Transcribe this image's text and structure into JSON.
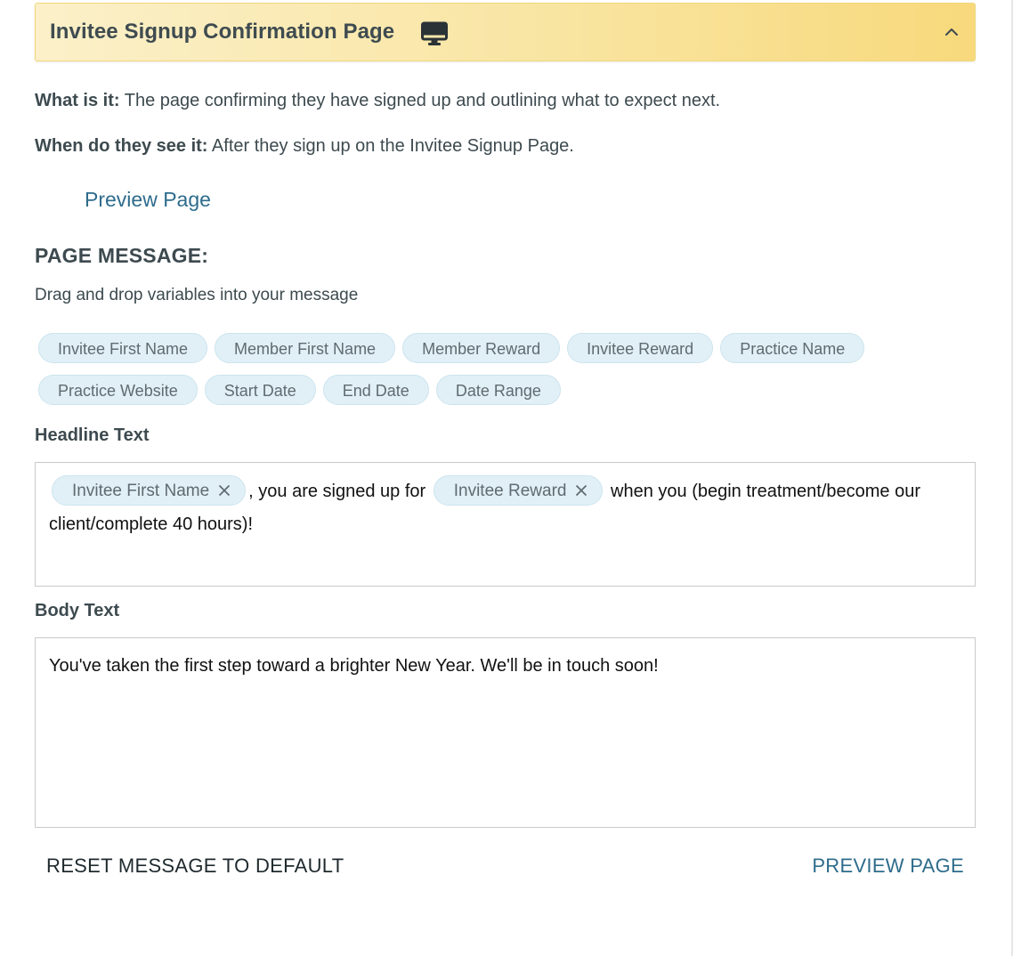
{
  "accordion": {
    "title": "Invitee Signup Confirmation Page",
    "icon": "monitor-icon",
    "toggle_icon": "chevron-up-icon"
  },
  "info": {
    "what_label": "What is it:",
    "what_text": " The page confirming they have signed up and outlining what to expect next.",
    "when_label": "When do they see it:",
    "when_text": " After they sign up on the Invitee Signup Page."
  },
  "preview_link": "Preview Page",
  "message_section": {
    "title": "PAGE MESSAGE:",
    "subtitle": "Drag and drop variables into your message"
  },
  "variables": {
    "row1": [
      "Invitee First Name",
      "Member First Name",
      "Member Reward",
      "Invitee Reward",
      "Practice Name"
    ],
    "row2": [
      "Practice Website",
      "Start Date",
      "End Date",
      "Date Range"
    ]
  },
  "headline": {
    "label": "Headline Text",
    "chip1": "Invitee First Name",
    "text1": ", you are signed up for",
    "chip2": "Invitee Reward",
    "text2": "when you (begin treatment/become our client/complete 40 hours)!"
  },
  "body": {
    "label": "Body Text",
    "text": "You've taken the first step toward a brighter New Year. We'll be in touch soon!"
  },
  "actions": {
    "reset": "RESET MESSAGE TO DEFAULT",
    "preview": "PREVIEW PAGE"
  },
  "colors": {
    "accent_link": "#2e6c8c",
    "header_gradient_start": "#fbf0c9",
    "header_gradient_end": "#f8d97c",
    "chip_bg": "#e1f0f7"
  }
}
